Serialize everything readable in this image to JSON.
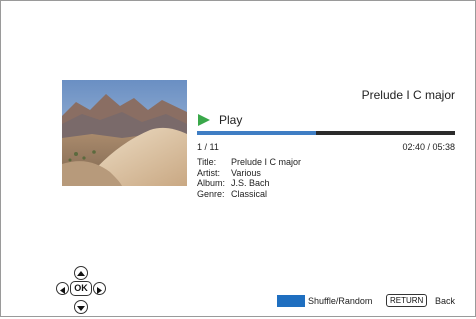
{
  "now_playing": {
    "title": "Prelude I C major",
    "status_label": "Play",
    "play_icon": "play-icon",
    "progress_fraction": 0.46,
    "track_counter": "1 / 11",
    "time_readout": "02:40 / 05:38"
  },
  "info": [
    {
      "key": "Title:",
      "value": "Prelude I C major"
    },
    {
      "key": "Artist:",
      "value": "Various"
    },
    {
      "key": "Album:",
      "value": "J.S. Bach"
    },
    {
      "key": "Genre:",
      "value": "Classical"
    }
  ],
  "controls": {
    "ok_label": "OK",
    "shuffle_label": "Shuffle/Random",
    "return_label": "RETURN",
    "back_label": "Back"
  },
  "colors": {
    "progress_fill": "#3f7ec4",
    "progress_track": "#2b2b2b",
    "play_icon": "#3aa84a",
    "blue_key": "#1f6fc0"
  }
}
